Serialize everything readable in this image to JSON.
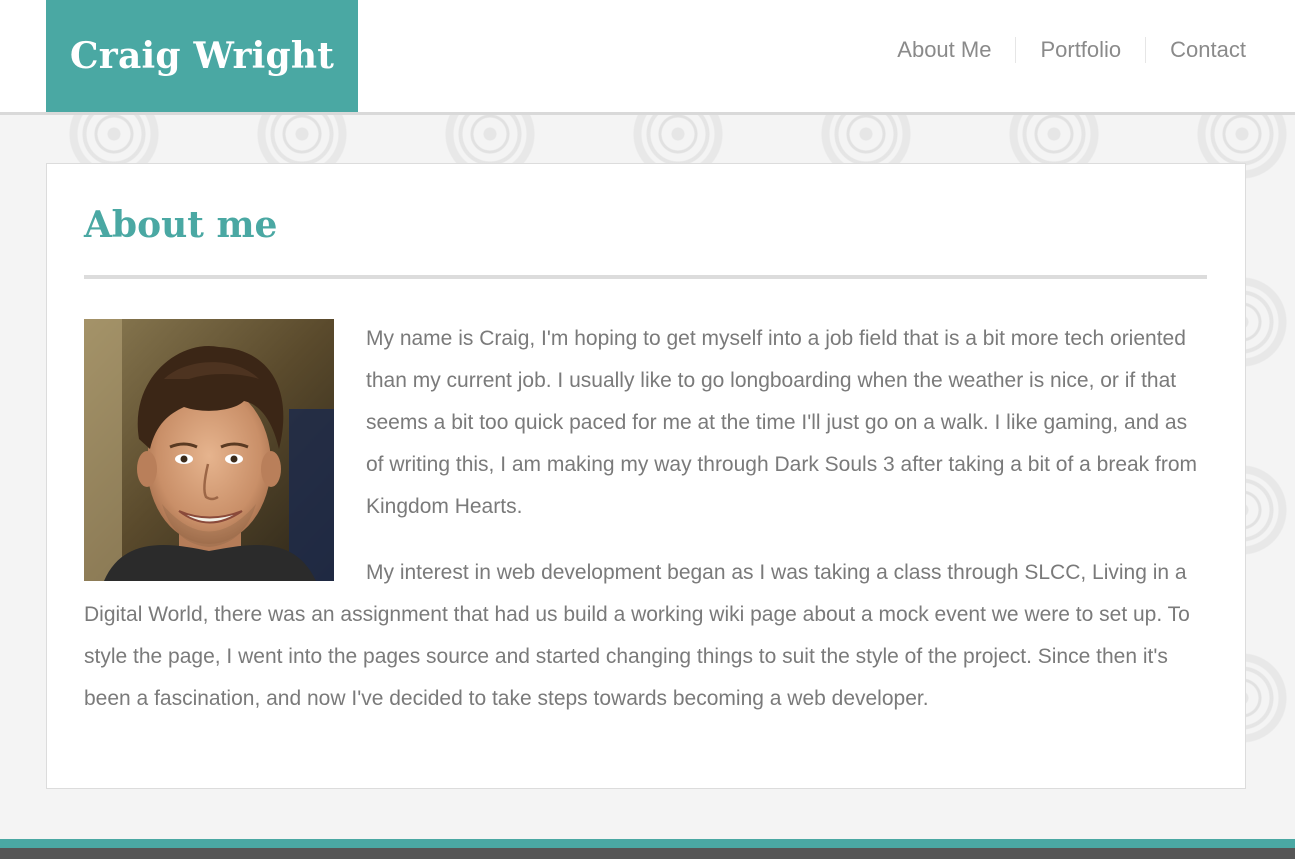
{
  "header": {
    "brand": "Craig Wright",
    "nav": [
      {
        "label": "About Me"
      },
      {
        "label": "Portfolio"
      },
      {
        "label": "Contact"
      }
    ]
  },
  "main": {
    "heading": "About me",
    "photo_alt": "Photo of Craig Wright",
    "paragraphs": [
      "My name is Craig, I'm hoping to get myself into a job field that is a bit more tech oriented than my current job. I usually like to go longboarding when the weather is nice, or if that seems a bit too quick paced for me at the time I'll just go on a walk. I like gaming, and as of writing this, I am making my way through Dark Souls 3 after taking a bit of a break from Kingdom Hearts.",
      "My interest in web development began as I was taking a class through SLCC, Living in a Digital World, there was an assignment that had us build a working wiki page about a mock event we were to set up. To style the page, I went into the pages source and started changing things to suit the style of the project. Since then it's been a fascination, and now I've decided to take steps towards becoming a web developer."
    ]
  },
  "colors": {
    "accent": "#4aa8a3",
    "text": "#7a7a7a",
    "nav_text": "#8a8a8a",
    "footer_dark": "#555555"
  }
}
